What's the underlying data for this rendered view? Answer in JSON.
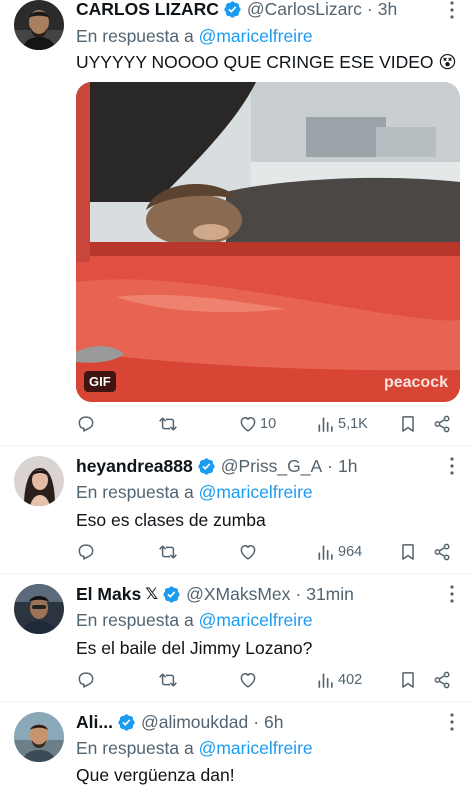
{
  "tweets": [
    {
      "name": "CARLOS LIZARC",
      "handle": "@CarlosLizarc",
      "time": "3h",
      "reply_prefix": "En respuesta a",
      "reply_to": "@maricelfreire",
      "text": "UYYYYY NOOOO QUE CRINGE ESE VIDEO 😵",
      "gif_badge": "GIF",
      "watermark": "peacock",
      "likes": "10",
      "views": "5,1K"
    },
    {
      "name": "heyandrea888",
      "handle": "@Priss_G_A",
      "time": "1h",
      "reply_prefix": "En respuesta a",
      "reply_to": "@maricelfreire",
      "text": "Eso es clases de zumba",
      "views": "964"
    },
    {
      "name": "El Maks",
      "name_suffix": "𝕏",
      "handle": "@XMaksMex",
      "time": "31min",
      "reply_prefix": "En respuesta a",
      "reply_to": "@maricelfreire",
      "text": "Es el baile del Jimmy Lozano?",
      "views": "402"
    },
    {
      "name": "Ali...",
      "handle": "@alimoukdad",
      "time": "6h",
      "reply_prefix": "En respuesta a",
      "reply_to": "@maricelfreire",
      "text": "Que vergüenza dan!"
    }
  ],
  "separator": "·",
  "colors": {
    "accent": "#1d9bf0",
    "secondary_text": "#536471"
  }
}
